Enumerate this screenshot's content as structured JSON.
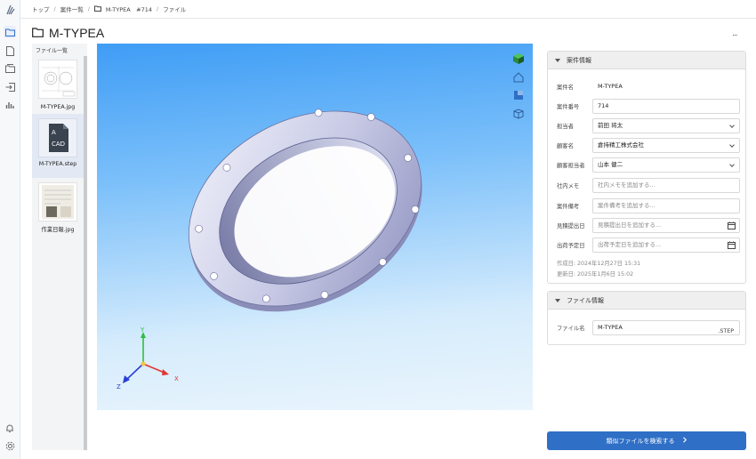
{
  "breadcrumb": {
    "items": [
      "トップ",
      "案件一覧",
      "M-TYPEA　#714",
      "ファイル"
    ]
  },
  "page": {
    "title": "M-TYPEA",
    "more_label": "..."
  },
  "file_list": {
    "header": "ファイル一覧",
    "items": [
      {
        "name": "M-TYPEA.jpg"
      },
      {
        "name": "M-TYPEA.step",
        "badge": "CAD",
        "selected": true
      },
      {
        "name": "作業日報.jpg"
      }
    ]
  },
  "viewer": {
    "axes": {
      "x": "X",
      "y": "Y",
      "z": "Z"
    },
    "colors": {
      "x": "#e3342f",
      "y": "#2fbf3a",
      "z": "#2a3fd8"
    }
  },
  "case_info": {
    "header": "案件情報",
    "fields": [
      {
        "label": "案件名",
        "value": "M-TYPEA"
      },
      {
        "label": "案件番号",
        "value": "714"
      },
      {
        "label": "担当者",
        "value": "前田 将太"
      },
      {
        "label": "顧客名",
        "value": "倉持精工株式会社"
      },
      {
        "label": "顧客担当者",
        "value": "山本 健二"
      },
      {
        "label": "社内メモ",
        "placeholder": "社内メモを追加する..."
      },
      {
        "label": "案件備考",
        "placeholder": "案件備考を追加する..."
      },
      {
        "label": "見積提出日",
        "placeholder": "見積提出日を追加する..."
      },
      {
        "label": "出荷予定日",
        "placeholder": "出荷予定日を追加する..."
      }
    ],
    "created": "作成日: 2024年12月27日 15:31",
    "updated": "更新日: 2025年1月6日 15:02"
  },
  "file_info": {
    "header": "ファイル情報",
    "label": "ファイル名",
    "value": "M-TYPEA",
    "ext": ".STEP"
  },
  "actions": {
    "search_similar": "類似ファイルを検索する"
  },
  "colors": {
    "accent": "#2f6fc6",
    "viewer_top": "#3f9df5",
    "viewer_bottom": "#eaf5fd"
  }
}
